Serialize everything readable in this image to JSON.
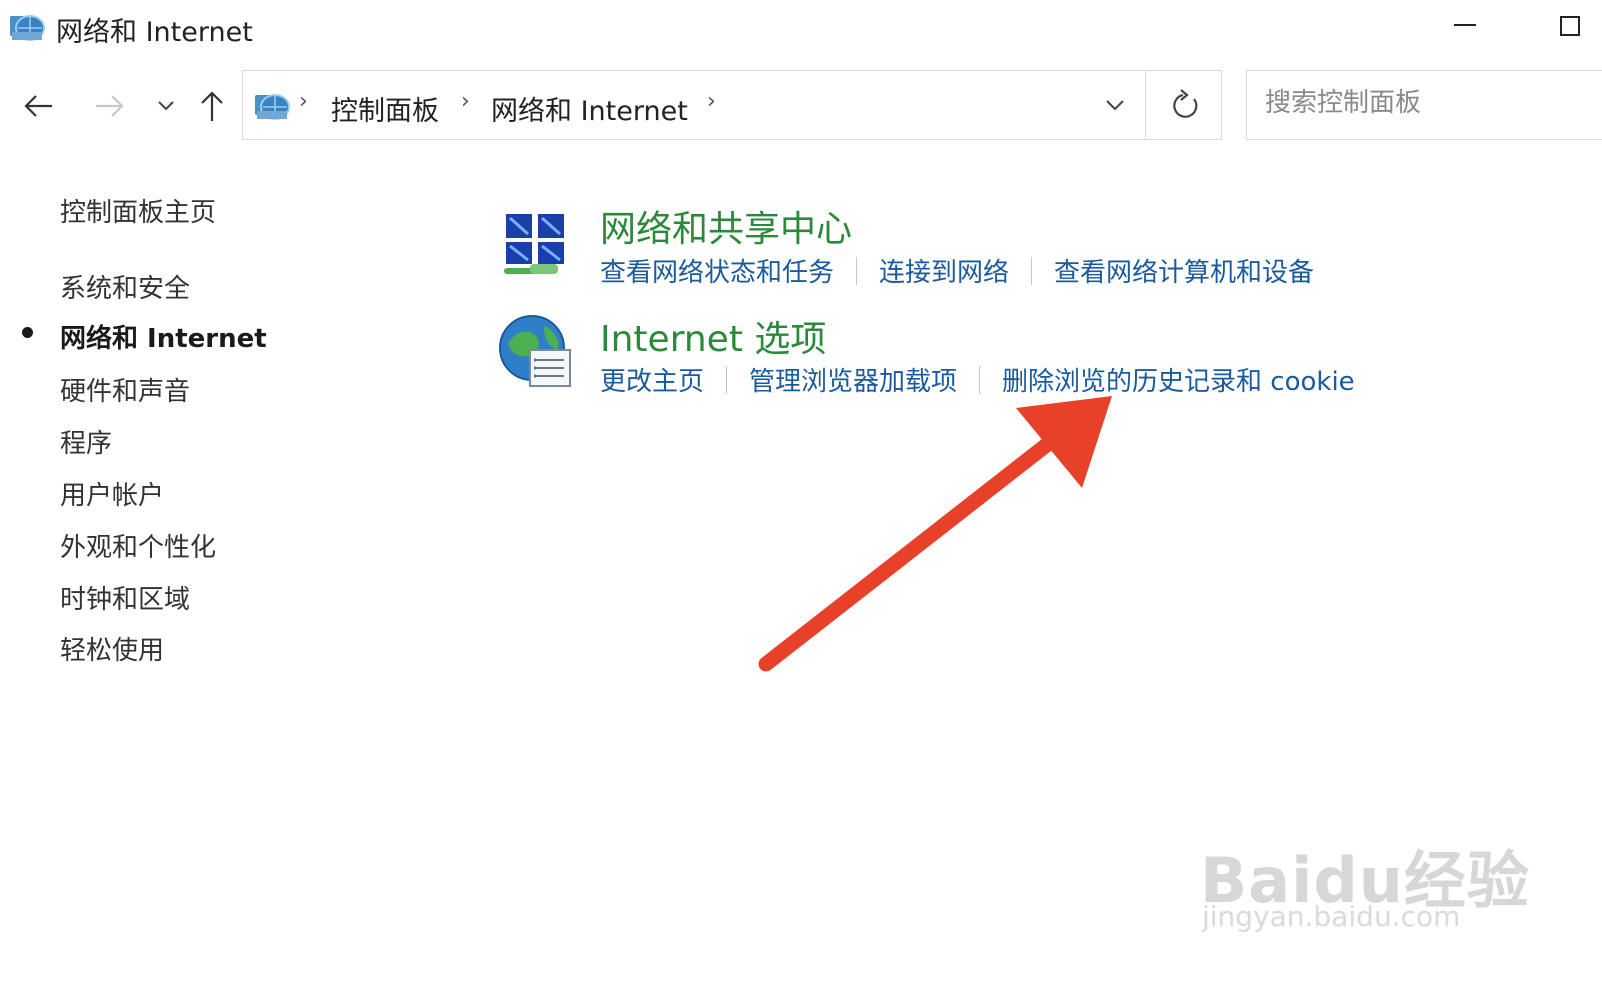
{
  "window": {
    "title": "网络和 Internet"
  },
  "nav": {
    "breadcrumbs": [
      "控制面板",
      "网络和 Internet"
    ],
    "search_placeholder": "搜索控制面板"
  },
  "sidebar": {
    "items": [
      {
        "label": "控制面板主页",
        "active": false
      },
      {
        "label": "系统和安全",
        "active": false
      },
      {
        "label": "网络和 Internet",
        "active": true
      },
      {
        "label": "硬件和声音",
        "active": false
      },
      {
        "label": "程序",
        "active": false
      },
      {
        "label": "用户帐户",
        "active": false
      },
      {
        "label": "外观和个性化",
        "active": false
      },
      {
        "label": "时钟和区域",
        "active": false
      },
      {
        "label": "轻松使用",
        "active": false
      }
    ]
  },
  "categories": [
    {
      "title": "网络和共享中心",
      "icon": "network-sharing-center-icon",
      "links": [
        "查看网络状态和任务",
        "连接到网络",
        "查看网络计算机和设备"
      ]
    },
    {
      "title": "Internet 选项",
      "icon": "internet-options-icon",
      "links": [
        "更改主页",
        "管理浏览器加载项",
        "删除浏览的历史记录和 cookie"
      ]
    }
  ],
  "watermark": {
    "main": "Bai",
    "paw": "du",
    "suffix": "经验",
    "url": "jingyan.baidu.com"
  },
  "colors": {
    "category_title": "#2a8a3a",
    "link": "#1a5a9e",
    "annotation_arrow": "#e8412a"
  }
}
